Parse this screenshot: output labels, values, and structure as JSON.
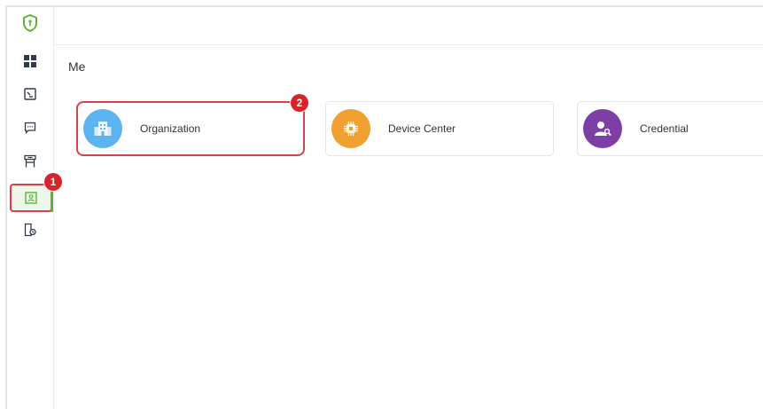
{
  "page": {
    "title": "Me"
  },
  "sidebar": {
    "items": [
      {
        "name": "dashboard",
        "icon": "grid-icon"
      },
      {
        "name": "monitor",
        "icon": "monitor-icon"
      },
      {
        "name": "messages",
        "icon": "chat-icon"
      },
      {
        "name": "access",
        "icon": "turnstile-icon"
      },
      {
        "name": "me",
        "icon": "person-badge-icon",
        "active": true
      },
      {
        "name": "records",
        "icon": "document-icon"
      }
    ],
    "active_badge": "1"
  },
  "cards": [
    {
      "label": "Organization",
      "icon": "building-icon",
      "color": "#5bb4ef",
      "highlight_badge": "2"
    },
    {
      "label": "Device Center",
      "icon": "chip-icon",
      "color": "#f0a031"
    },
    {
      "label": "Credential",
      "icon": "user-key-icon",
      "color": "#7d3fa6"
    }
  ],
  "colors": {
    "accent": "#5db33a",
    "highlight": "#d9404a",
    "badge": "#d8232a"
  }
}
